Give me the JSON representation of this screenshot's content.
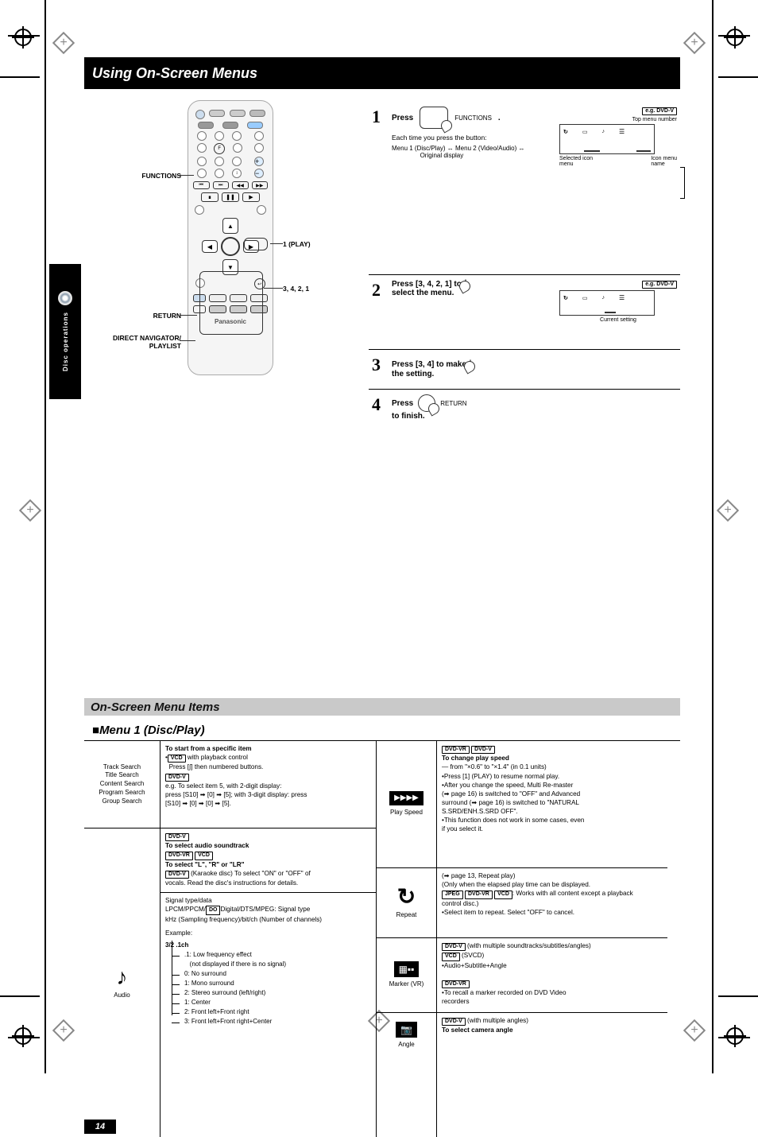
{
  "header": {
    "title": "Using On-Screen Menus"
  },
  "side_tab": {
    "label": "Disc operations"
  },
  "remote": {
    "brand": "Panasonic",
    "labels": {
      "functions": "FUNCTIONS",
      "return": "RETURN",
      "navigator": "DIRECT NAVIGATOR/\nPLAYLIST",
      "play": "1 (PLAY)",
      "arrows": "3, 4, 2, 1"
    }
  },
  "steps": {
    "s1": {
      "num": "1",
      "press": "Press",
      "btn": "FUNCTIONS",
      "note": "Each time you press the button:",
      "seq": "Menu 1 (Disc/Play) ↔ Menu 2 (Video/Audio) ↔\n                Original display",
      "eg_label": "e.g. DVD-V",
      "osd_caption": "Top menu number",
      "osd_sel": "Selected icon\nmenu",
      "osd_name": "Icon menu\nname"
    },
    "s2": {
      "num": "2",
      "press_pre": "Press ",
      "arrows": "[3, 4, 2, 1]",
      "press_post": " to",
      "line2": "select the menu.",
      "eg_label": "e.g. DVD-V",
      "osd_caption": "Current setting"
    },
    "s3": {
      "num": "3",
      "press_pre": "Press ",
      "arrows": "[3, 4]",
      "press_post": " to make",
      "line2": "the setting."
    },
    "s4": {
      "num": "4",
      "press": "Press",
      "btn": "RETURN",
      "line2": "to finish."
    }
  },
  "grey_bar": "On-Screen Menu Items",
  "sub_head": "Menu 1 (Disc/Play)",
  "menuL": {
    "track": {
      "label": "Track Search\nTitle Search\nContent Search\nProgram Search\nGroup Search",
      "body1": "To start from a specific item",
      "vcd_note": " with playback control",
      "vcd_note2": "Press [∫] then numbered buttons.",
      "dvdv": "e.g. To select item 5, with 2-digit display:\npress [S10] ➡ [0] ➡ [5]; with 3-digit display: press\n[S10] ➡ [0] ➡ [0] ➡ [5]."
    },
    "audio": {
      "label": "Audio",
      "line1": "To select audio soundtrack",
      "line2": "To select \"L\", \"R\" or \"LR\"",
      "line3": "(Karaoke disc) To select \"ON\" or \"OFF\" of\nvocals. Read the disc's instructions for details.",
      "sig": "Signal type/data\nLPCM/PPCM/DODigital/DTS/MPEG: Signal type\nkHz (Sampling frequency)/bit/ch (Number of channels)",
      "dolby": "DO",
      "example": "Example:",
      "tree": {
        "a": "3/2 .1ch",
        "b_label": ".1: Low frequency effect",
        "b_sub": "(not displayed if there is no signal)",
        "c": "0: No surround",
        "d": "1: Mono surround",
        "e": "2: Stereo surround (left/right)",
        "f": "1: Center",
        "g": "2: Front left+Front right",
        "h": "3: Front left+Front right+Center"
      }
    }
  },
  "menuR": {
    "speed": {
      "icon": "▶▶▶▶",
      "label": "Play Speed",
      "line1": "To change play speed",
      "line2": "— from \"×0.6\" to \"×1.4\" (in 0.1 units)",
      "b1": "Press [1] (PLAY) to resume normal play.",
      "b2": "After you change the speed, Multi Re-master\n(➡ page 16) is switched to \"OFF\" and Advanced\nsurround (➡ page 16) is switched to \"NATURAL\nS.SRD/ENH.S.SRD OFF\".",
      "b3": "This function does not work in some cases, even\nif you select it."
    },
    "repeat": {
      "label": "Repeat",
      "line1": "(➡ page 13, Repeat play)",
      "line2": "(Only when the elapsed play time can be displayed.",
      "line3": ": Works with all JPEG content. DVD-VR\nVCD: Works with all content except a playback\ncontrol disc.)",
      "b1": "Select item to repeat. Select \"OFF\" to cancel."
    },
    "marker": {
      "label": "Marker (VR)",
      "line1a": "DVD-V (with multiple soundtracks/subtitles/angles)",
      "line1b": "VCD (SVCD)",
      "b1": "Audio+Subtitle+Angle",
      "line2": "DVD-VR",
      "b2": "To recall a marker recorded on DVD Video\nrecorders"
    },
    "angle": {
      "label": "Angle",
      "line1": "DVD-V (with multiple angles)",
      "line2": "To select camera angle"
    }
  },
  "page_number": "14"
}
